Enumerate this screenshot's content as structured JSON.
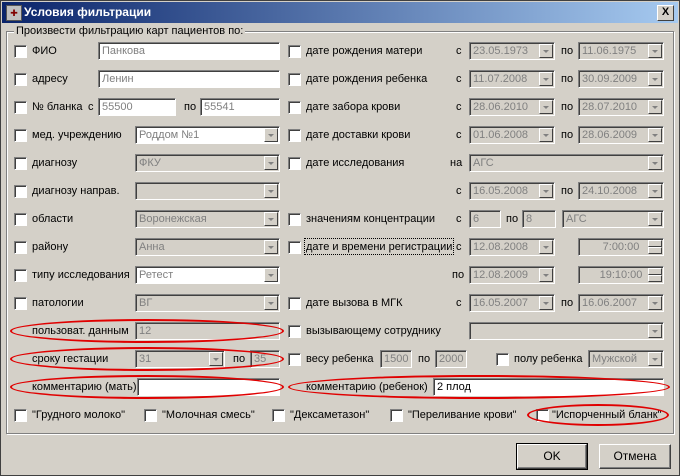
{
  "window": {
    "title": "Условия фильтрации",
    "close": "X",
    "app_icon": "app-icon"
  },
  "group_label": "Произвести фильтрацию карт пациентов по:",
  "left": {
    "fio": {
      "label": "ФИО",
      "value": "Панкова"
    },
    "address": {
      "label": "адресу",
      "value": "Ленин"
    },
    "blank": {
      "label": "№ бланка",
      "from_label": "с",
      "from": "55500",
      "to_label": "по",
      "to": "55541"
    },
    "med": {
      "label": "мед. учреждению",
      "value": "Роддом №1"
    },
    "diag": {
      "label": "диагнозу",
      "value": "ФКУ"
    },
    "diag_dir": {
      "label": "диагнозу направ.",
      "value": ""
    },
    "region": {
      "label": "области",
      "value": "Воронежская"
    },
    "district": {
      "label": "району",
      "value": "Анна"
    },
    "type": {
      "label": "типу исследования",
      "value": "Ретест"
    },
    "pathology": {
      "label": "патологии",
      "value": "ВГ"
    },
    "user_data": {
      "label": "пользоват. данным",
      "value": "12"
    },
    "gest": {
      "label": "сроку гестации",
      "from": "31",
      "to_label": "по",
      "to": "35"
    },
    "comment_mother": {
      "label": "комментарию (мать)",
      "value": ""
    }
  },
  "right": {
    "mother_birth": {
      "label": "дате рождения матери",
      "from_label": "с",
      "from": "23.05.1973",
      "to_label": "по",
      "to": "11.06.1975"
    },
    "child_birth": {
      "label": "дате рождения ребенка",
      "from_label": "с",
      "from": "11.07.2008",
      "to_label": "по",
      "to": "30.09.2009"
    },
    "blood_take": {
      "label": "дате забора крови",
      "from_label": "с",
      "from": "28.06.2010",
      "to_label": "по",
      "to": "28.07.2010"
    },
    "blood_delivery": {
      "label": "дате доставки крови",
      "from_label": "с",
      "from": "01.06.2008",
      "to_label": "по",
      "to": "28.06.2009"
    },
    "research": {
      "label": "дате исследования",
      "on_label": "на",
      "on_value": "АГС",
      "from_label": "с",
      "from": "16.05.2008",
      "to_label": "по",
      "to": "24.10.2008"
    },
    "concentration": {
      "label": "значениям концентрации",
      "from_label": "с",
      "from": "6",
      "to_label": "по",
      "to": "8",
      "test": "АГС"
    },
    "registration": {
      "label": "дате и времени регистрации",
      "from_label": "с",
      "from_date": "12.08.2008",
      "from_time": "7:00:00",
      "to_label": "по",
      "to_date": "12.08.2009",
      "to_time": "19:10:00"
    },
    "mgk": {
      "label": "дате вызова в МГК",
      "from_label": "с",
      "from": "16.05.2007",
      "to_label": "по",
      "to": "16.06.2007"
    },
    "employee": {
      "label": "вызывающему сотруднику",
      "value": ""
    },
    "weight": {
      "label": "весу ребенка",
      "from": "1500",
      "to_label": "по",
      "to": "2000"
    },
    "sex": {
      "label": "полу ребенка",
      "value": "Мужской"
    },
    "comment_child": {
      "label": "комментарию (ребенок)",
      "value": "2 плод"
    }
  },
  "bottom_flags": [
    "\"Грудного молоко\"",
    "\"Молочная смесь\"",
    "\"Дексаметазон\"",
    "\"Переливание крови\"",
    "\"Испорченный бланк\""
  ],
  "buttons": {
    "ok": "OK",
    "cancel": "Отмена"
  },
  "colors": {
    "highlight": "#e00000",
    "title_start": "#0a246a",
    "title_end": "#a6caf0"
  }
}
